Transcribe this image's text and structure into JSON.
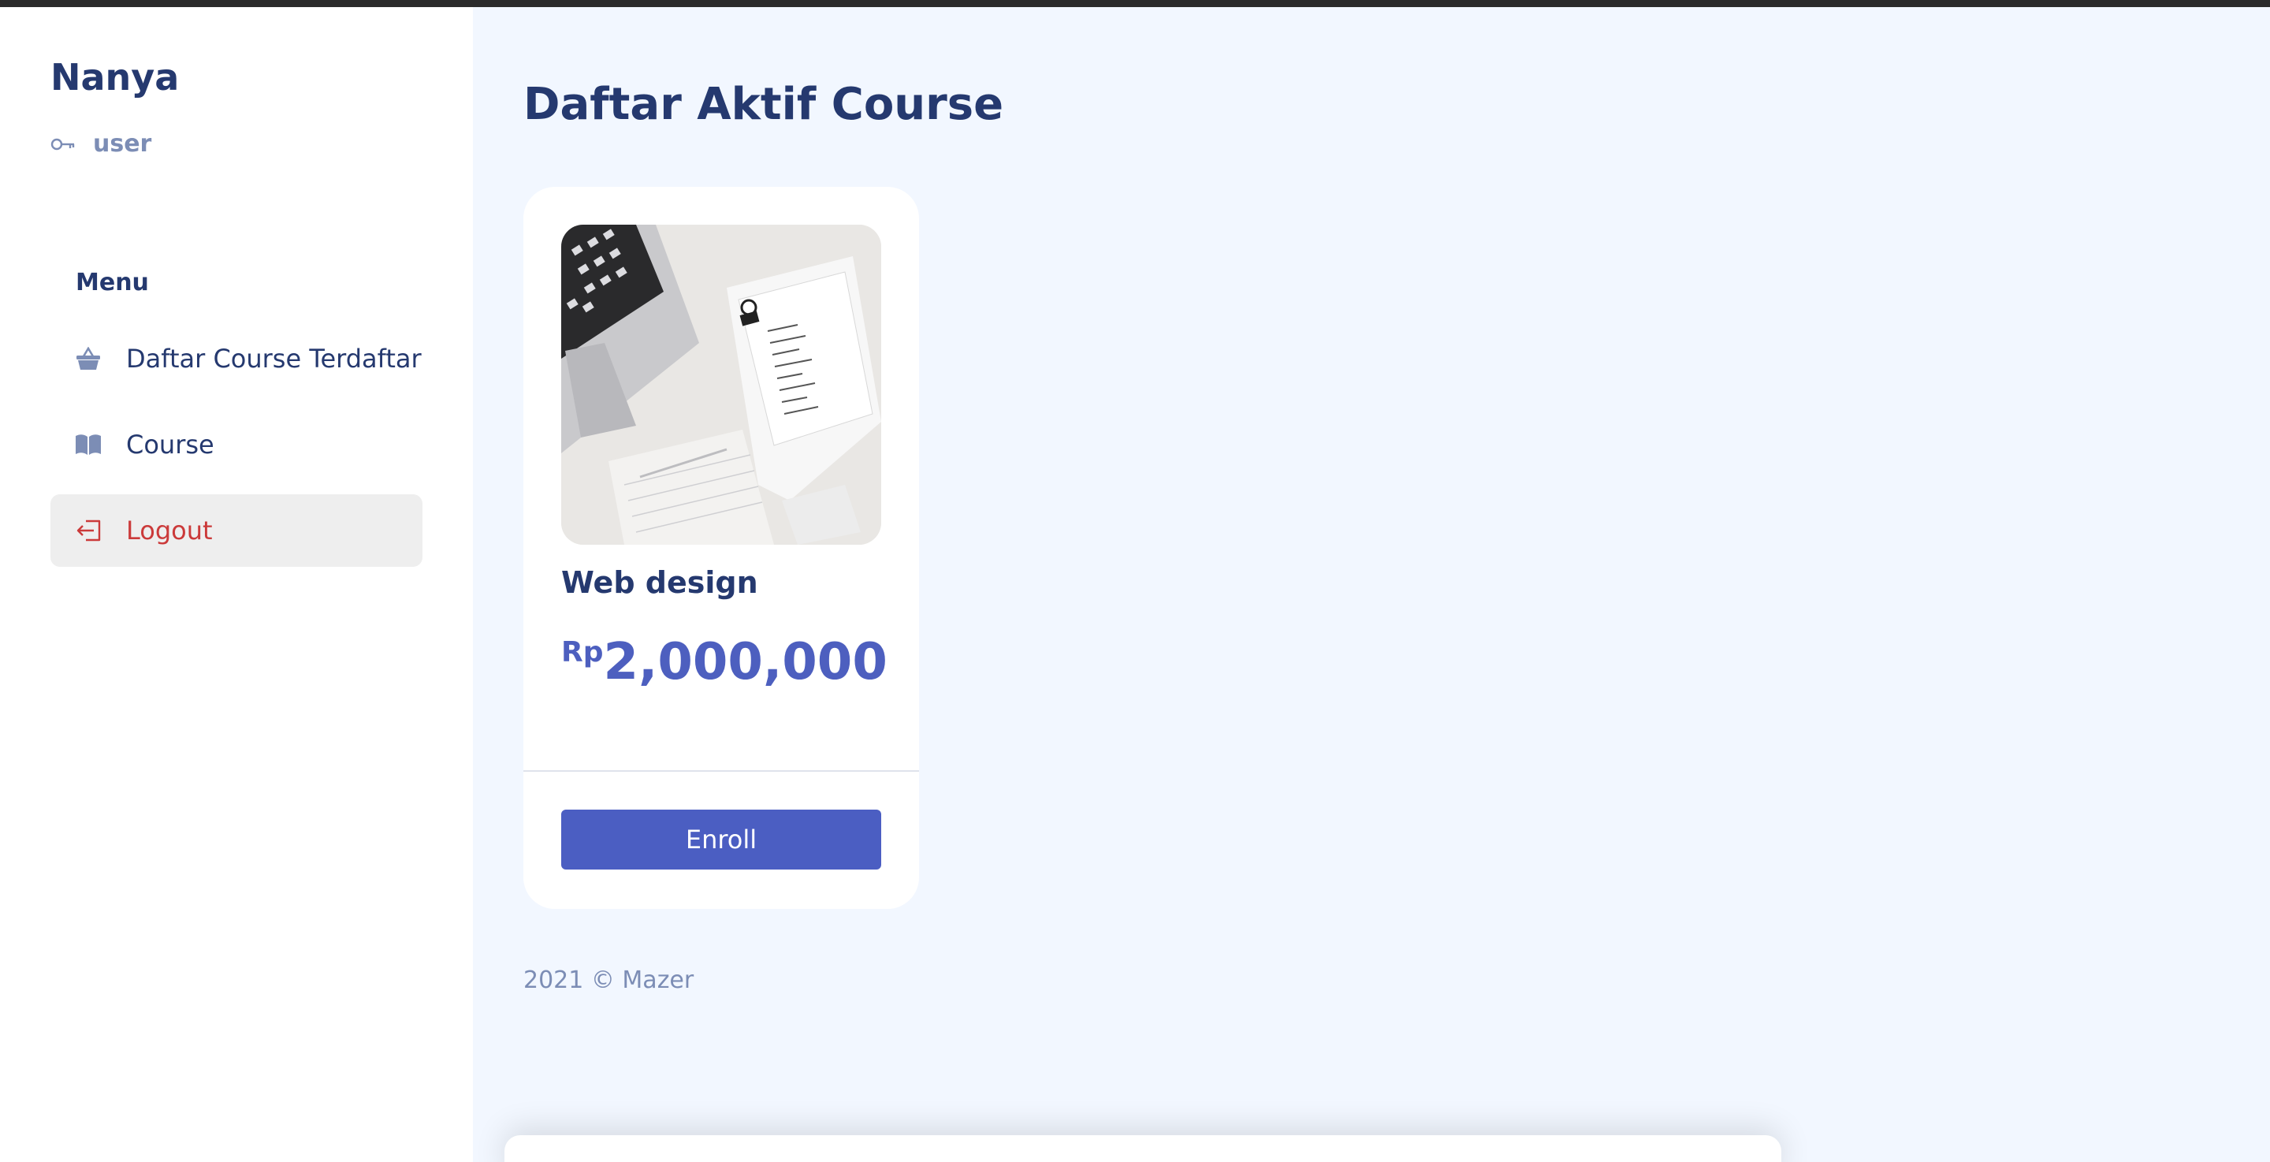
{
  "sidebar": {
    "brand": "Nanya",
    "role": "user",
    "menu_title": "Menu",
    "items": [
      {
        "label": "Daftar Course Terdaftar",
        "icon": "basket-icon"
      },
      {
        "label": "Course",
        "icon": "book-icon"
      },
      {
        "label": "Logout",
        "icon": "logout-icon",
        "active": true
      }
    ]
  },
  "main": {
    "title": "Daftar Aktif Course",
    "courses": [
      {
        "title": "Web design",
        "currency": "Rp",
        "price": "2,000,000",
        "button_label": "Enroll"
      }
    ],
    "footer": "2021 © Mazer"
  },
  "colors": {
    "primary": "#4b5ec2",
    "heading": "#25396f",
    "muted": "#7c8db5",
    "logout": "#cb3a3a",
    "background": "#f2f7ff"
  }
}
